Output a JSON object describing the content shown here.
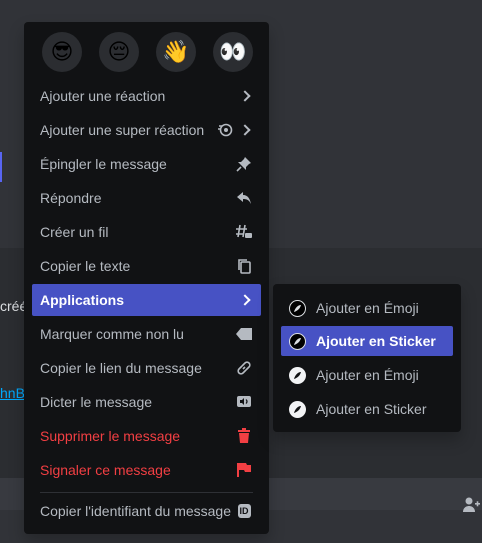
{
  "background": {
    "fragment_a": "créé",
    "fragment_b": "hnB",
    "right_icon": "person-add-icon"
  },
  "quick_reactions": [
    {
      "emoji": "😎",
      "name": "sunglasses-emoji"
    },
    {
      "emoji": "😔",
      "name": "pensive-emoji"
    },
    {
      "emoji": "👋",
      "name": "wave-emoji"
    },
    {
      "emoji": "👀",
      "name": "eyes-emoji"
    }
  ],
  "menu": {
    "add_reaction": "Ajouter une réaction",
    "add_super_reaction": "Ajouter une super réaction",
    "pin": "Épingler le message",
    "reply": "Répondre",
    "create_thread": "Créer un fil",
    "copy_text": "Copier le texte",
    "applications": "Applications",
    "mark_unread": "Marquer comme non lu",
    "copy_link": "Copier le lien du message",
    "dictate": "Dicter le message",
    "delete": "Supprimer le message",
    "report": "Signaler ce message",
    "copy_id": "Copier l'identifiant du message",
    "id_badge": "ID"
  },
  "submenu": [
    {
      "label": "Ajouter en Émoji",
      "style": "dark"
    },
    {
      "label": "Ajouter en Sticker",
      "style": "dark",
      "active": true
    },
    {
      "label": "Ajouter en Émoji",
      "style": "light"
    },
    {
      "label": "Ajouter en Sticker",
      "style": "light"
    }
  ],
  "colors": {
    "accent": "#4752c4",
    "danger": "#f23f43",
    "menu_bg": "#111214",
    "text": "#b5bac1"
  }
}
